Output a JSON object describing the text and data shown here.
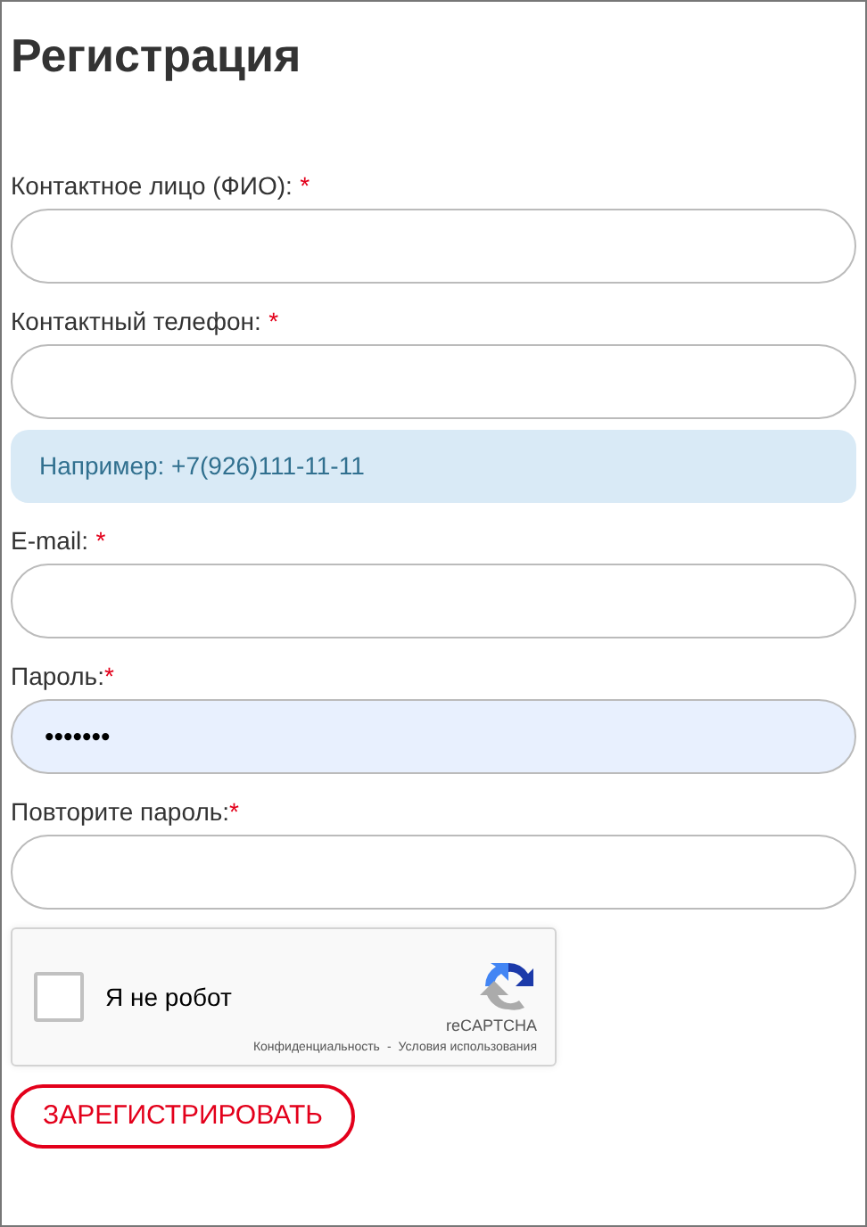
{
  "title": "Регистрация",
  "fields": [
    {
      "kind": "input",
      "label": "Контактное лицо (ФИО):",
      "mark": "*",
      "mark_spaced": true,
      "autofilled": false
    },
    {
      "kind": "input",
      "label": "Контактный телефон:",
      "mark": "*",
      "mark_spaced": true,
      "autofilled": false
    },
    {
      "kind": "hint",
      "text": "Например: +7(926)111-11-11"
    },
    {
      "kind": "input",
      "label": "E-mail:",
      "mark": "*",
      "mark_spaced": true,
      "autofilled": false
    },
    {
      "kind": "input",
      "label": "Пароль:",
      "mark": "*",
      "mark_spaced": false,
      "value": "•••••••",
      "autofilled": true
    },
    {
      "kind": "input",
      "label": "Повторите пароль:",
      "mark": "*",
      "mark_spaced": false,
      "autofilled": false
    }
  ],
  "captcha": {
    "checked": false,
    "label": "Я не робот",
    "brand": "reCAPTCHA",
    "privacy": "Конфиденциальность",
    "separator": "-",
    "terms": "Условия использования"
  },
  "submit": "ЗАРЕГИСТРИРОВАТЬ"
}
